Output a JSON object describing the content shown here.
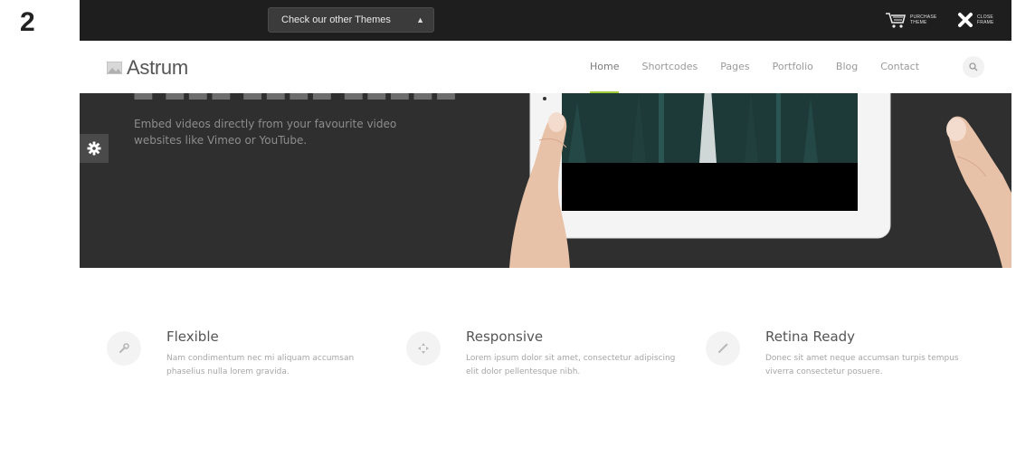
{
  "step_number": "2",
  "themebar": {
    "theme_select_value": "Check our other Themes",
    "purchase_label": "Purchase Theme",
    "close_label": "Close Frame"
  },
  "navbar": {
    "logo_text": "Astrum",
    "menu": [
      {
        "label": "Home",
        "active": true
      },
      {
        "label": "Shortcodes"
      },
      {
        "label": "Pages"
      },
      {
        "label": "Portfolio"
      },
      {
        "label": "Blog"
      },
      {
        "label": "Contact"
      }
    ]
  },
  "hero": {
    "description": "Embed videos directly from your favourite video websites like Vimeo or YouTube."
  },
  "features": [
    {
      "title": "Flexible",
      "description": "Nam condimentum nec mi aliquam accumsan phaselius nulla lorem gravida.",
      "icon": "wrench-icon"
    },
    {
      "title": "Responsive",
      "description": "Lorem ipsum dolor sit amet, consectetur adipiscing elit dolor pellentesque nibh.",
      "icon": "move-icon"
    },
    {
      "title": "Retina Ready",
      "description": "Donec sit amet neque accumsan turpis tempus viverra consectetur posuere.",
      "icon": "magic-wand-icon"
    }
  ],
  "colors": {
    "accent": "#9fcb35",
    "topbar": "#1e1e1e",
    "hero_bg": "#2f2f2f"
  }
}
